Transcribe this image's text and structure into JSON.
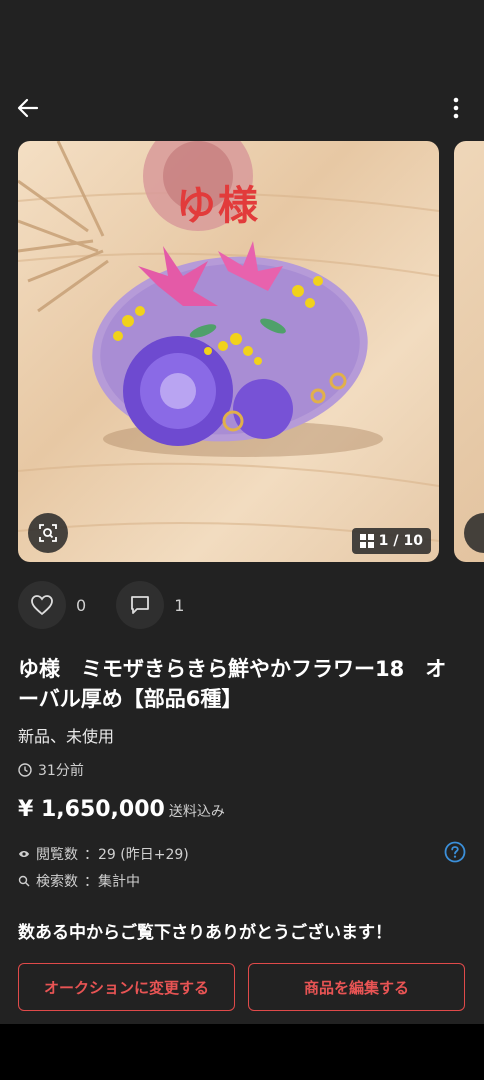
{
  "header": {
    "back_icon": "arrow-left-icon",
    "more_icon": "more-vertical-icon"
  },
  "gallery": {
    "overlay_text": "ゆ様",
    "counter_current": "1",
    "counter_sep": "/",
    "counter_total": "10",
    "zoom_icon": "image-search-icon",
    "grid_icon": "grid-icon"
  },
  "actions": {
    "likes": "0",
    "comments": "1"
  },
  "item": {
    "title": "ゆ様　ミモザきらきら鮮やかフラワー18　オーバル厚め【部品6種】",
    "condition": "新品、未使用",
    "posted": "31分前",
    "price": "¥ 1,650,000",
    "shipping": "送料込み",
    "views_label": "閲覧数",
    "views_value": "：29 (昨日+29)",
    "searches_label": "検索数",
    "searches_value": "：集計中"
  },
  "message": "数ある中からご覧下さりありがとうございます！",
  "buttons": {
    "auction": "オークションに変更する",
    "edit": "商品を編集する"
  },
  "colors": {
    "background": "#222222",
    "accent_red": "#e04a4a",
    "help_blue": "#3b8fd9"
  }
}
